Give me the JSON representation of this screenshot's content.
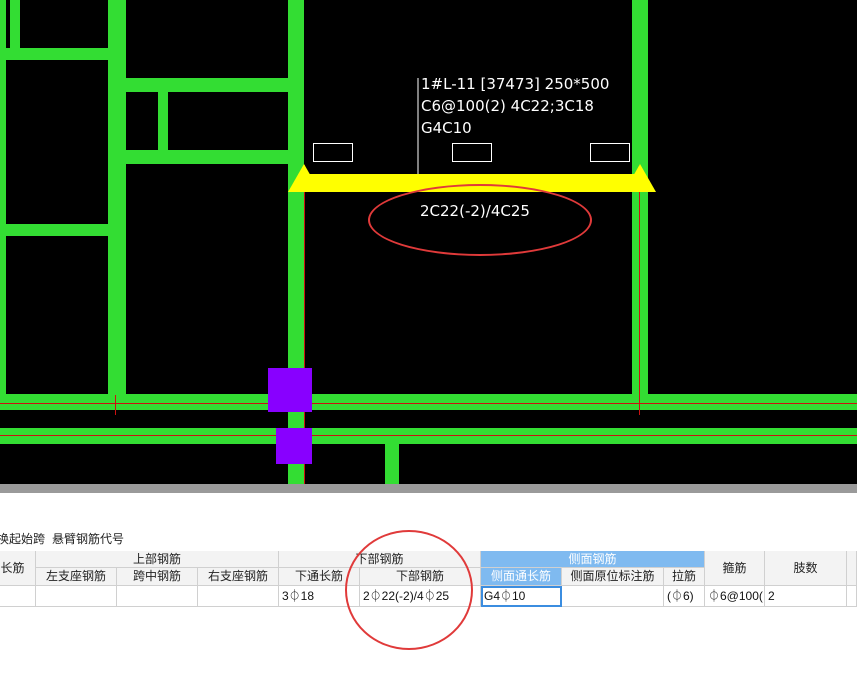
{
  "annotation": {
    "line1": "1#L-11 [37473] 250*500",
    "line2": "C6@100(2) 4C22;3C18",
    "line3": "G4C10",
    "bottom_rebar": "2C22(-2)/4C25"
  },
  "toolbar": {
    "item1": "换起始跨",
    "item2": "悬臂钢筋代号"
  },
  "table": {
    "groups": {
      "top": "上部钢筋",
      "bottom": "下部钢筋",
      "side": "侧面钢筋"
    },
    "headers": {
      "length_partial": "长筋",
      "left_support": "左支座钢筋",
      "mid_span": "跨中钢筋",
      "right_support": "右支座钢筋",
      "bottom_through": "下通长筋",
      "bottom_rebar": "下部钢筋",
      "side_through": "侧面通长筋",
      "side_original": "侧面原位标注筋",
      "tie": "拉筋",
      "stirrup": "箍筋",
      "legs": "肢数"
    },
    "row": {
      "bottom_through": "3⏀18",
      "bottom_rebar": "2⏀22(-2)/4⏀25",
      "side_through": "G4⏀10",
      "tie": "(⏀6)",
      "stirrup": "⏀6@100(",
      "legs": "2"
    }
  },
  "colors": {
    "beam_green": "#33dd33",
    "selected_beam": "#ffff00",
    "axis_red": "#cc1111",
    "column_purple": "#8800ff",
    "markup_circle": "#e03a3a",
    "side_header_blue": "#7fbaf0"
  }
}
